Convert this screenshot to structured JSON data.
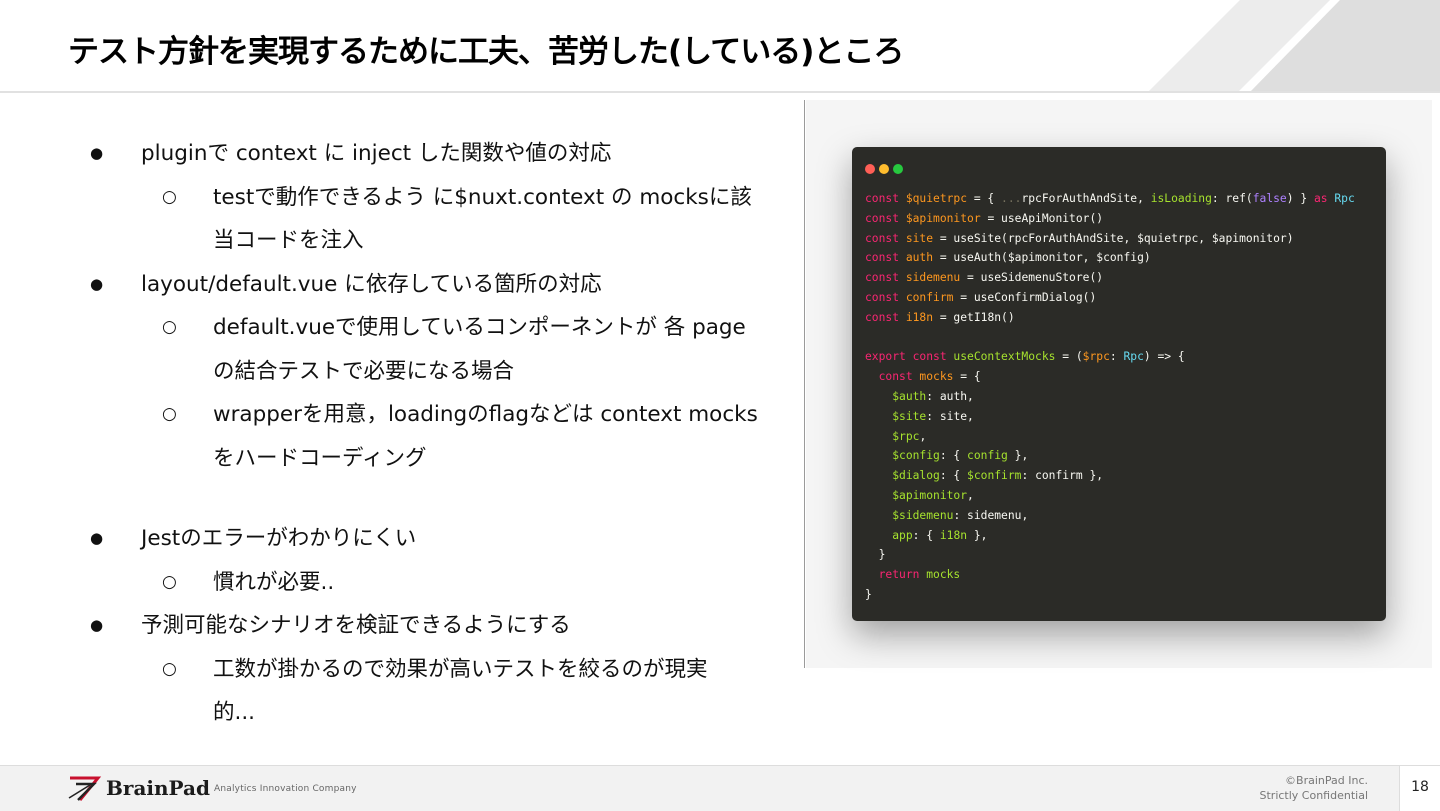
{
  "slide": {
    "title": "テスト方針を実現するために工夫、苦労した(している)ところ"
  },
  "bullets": [
    {
      "level": 1,
      "symbol": "●",
      "text": "pluginで context に inject した関数や値の対応"
    },
    {
      "level": 2,
      "symbol": "○",
      "text": "testで動作できるよう に$nuxt.context の mocksに該"
    },
    {
      "level": 2,
      "symbol": "",
      "text": "当コードを注入"
    },
    {
      "level": 1,
      "symbol": "●",
      "text": "layout/default.vue に依存している箇所の対応"
    },
    {
      "level": 2,
      "symbol": "○",
      "text": "default.vueで使用しているコンポーネントが 各 page"
    },
    {
      "level": 2,
      "symbol": "",
      "text": "の結合テストで必要になる場合"
    },
    {
      "level": 2,
      "symbol": "○",
      "text": "wrapperを用意，loadingのflagなどは context mocks"
    },
    {
      "level": 2,
      "symbol": "",
      "text": "をハードコーディング"
    },
    {
      "level": 0,
      "symbol": "",
      "text": ""
    },
    {
      "level": 1,
      "symbol": "●",
      "text": "Jestのエラーがわかりにくい"
    },
    {
      "level": 2,
      "symbol": "○",
      "text": "慣れが必要.."
    },
    {
      "level": 1,
      "symbol": "●",
      "text": "予測可能なシナリオを検証できるようにする"
    },
    {
      "level": 2,
      "symbol": "○",
      "text": "工数が掛かるので効果が高いテストを絞るのが現実"
    },
    {
      "level": 2,
      "symbol": "",
      "text": "的..."
    }
  ],
  "code_window": {
    "dot_colors": [
      "#ff5f56",
      "#ffbd2e",
      "#27c93f"
    ],
    "colors": {
      "background": "#2b2b27",
      "keyword": "#f92672",
      "identifier": "#fd971f",
      "function": "#a6e22e",
      "type": "#66d9ef",
      "boolean": "#ae81ff",
      "text": "#f8f8f2"
    },
    "lines": [
      [
        [
          "k",
          "const "
        ],
        [
          "v",
          "$quietrpc"
        ],
        [
          "t",
          " = { "
        ],
        [
          "c",
          "..."
        ],
        [
          "t",
          "rpcForAuthAndSite, "
        ],
        [
          "f",
          "isLoading"
        ],
        [
          "t",
          ": ref("
        ],
        [
          "b",
          "false"
        ],
        [
          "t",
          ") } "
        ],
        [
          "k",
          "as "
        ],
        [
          "ty",
          "Rpc"
        ]
      ],
      [
        [
          "k",
          "const "
        ],
        [
          "v",
          "$apimonitor"
        ],
        [
          "t",
          " = useApiMonitor()"
        ]
      ],
      [
        [
          "k",
          "const "
        ],
        [
          "v",
          "site"
        ],
        [
          "t",
          " = useSite(rpcForAuthAndSite, $quietrpc, $apimonitor)"
        ]
      ],
      [
        [
          "k",
          "const "
        ],
        [
          "v",
          "auth"
        ],
        [
          "t",
          " = useAuth($apimonitor, $config)"
        ]
      ],
      [
        [
          "k",
          "const "
        ],
        [
          "v",
          "sidemenu"
        ],
        [
          "t",
          " = useSidemenuStore()"
        ]
      ],
      [
        [
          "k",
          "const "
        ],
        [
          "v",
          "confirm"
        ],
        [
          "t",
          " = useConfirmDialog()"
        ]
      ],
      [
        [
          "k",
          "const "
        ],
        [
          "v",
          "i18n"
        ],
        [
          "t",
          " = getI18n()"
        ]
      ],
      [],
      [
        [
          "k",
          "export const "
        ],
        [
          "f",
          "useContextMocks"
        ],
        [
          "t",
          " = ("
        ],
        [
          "v",
          "$rpc"
        ],
        [
          "t",
          ": "
        ],
        [
          "ty",
          "Rpc"
        ],
        [
          "t",
          ") => {"
        ]
      ],
      [
        [
          "t",
          "  "
        ],
        [
          "k",
          "const "
        ],
        [
          "v",
          "mocks"
        ],
        [
          "t",
          " = {"
        ]
      ],
      [
        [
          "t",
          "    "
        ],
        [
          "f",
          "$auth"
        ],
        [
          "t",
          ": auth,"
        ]
      ],
      [
        [
          "t",
          "    "
        ],
        [
          "f",
          "$site"
        ],
        [
          "t",
          ": site,"
        ]
      ],
      [
        [
          "t",
          "    "
        ],
        [
          "f",
          "$rpc"
        ],
        [
          "t",
          ","
        ]
      ],
      [
        [
          "t",
          "    "
        ],
        [
          "f",
          "$config"
        ],
        [
          "t",
          ": { "
        ],
        [
          "f",
          "config"
        ],
        [
          "t",
          " },"
        ]
      ],
      [
        [
          "t",
          "    "
        ],
        [
          "f",
          "$dialog"
        ],
        [
          "t",
          ": { "
        ],
        [
          "f",
          "$confirm"
        ],
        [
          "t",
          ": confirm },"
        ]
      ],
      [
        [
          "t",
          "    "
        ],
        [
          "f",
          "$apimonitor"
        ],
        [
          "t",
          ","
        ]
      ],
      [
        [
          "t",
          "    "
        ],
        [
          "f",
          "$sidemenu"
        ],
        [
          "t",
          ": sidemenu,"
        ]
      ],
      [
        [
          "t",
          "    "
        ],
        [
          "f",
          "app"
        ],
        [
          "t",
          ": { "
        ],
        [
          "f",
          "i18n"
        ],
        [
          "t",
          " },"
        ]
      ],
      [
        [
          "t",
          "  }"
        ]
      ],
      [
        [
          "t",
          "  "
        ],
        [
          "k",
          "return "
        ],
        [
          "f",
          "mocks"
        ]
      ],
      [
        [
          "t",
          "}"
        ]
      ]
    ]
  },
  "footer": {
    "logo_text": "BrainPad",
    "logo_tagline": "Analytics Innovation Company",
    "copyright": "©BrainPad Inc.",
    "confidentiality": "Strictly Confidential",
    "page_number": "18"
  }
}
